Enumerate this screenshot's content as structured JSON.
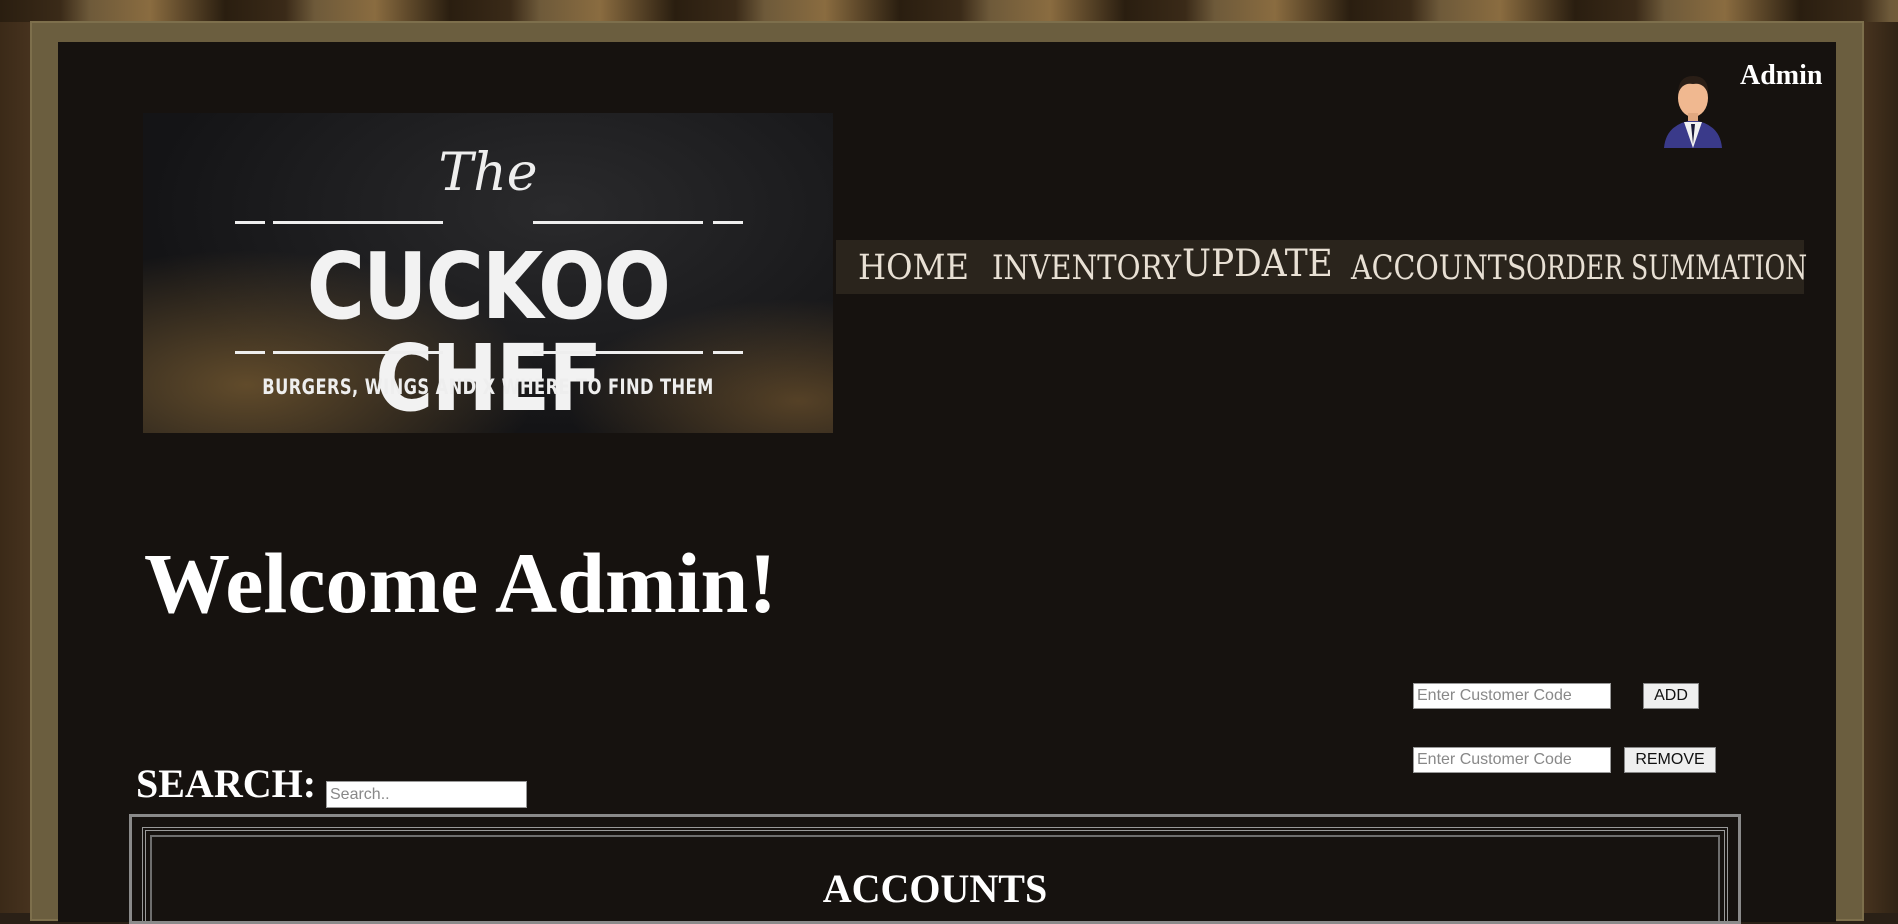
{
  "header": {
    "logo": {
      "the": "The",
      "name": "CUCKOO CHEF",
      "tagline": "BURGERS, WINGS AND X WHERE TO FIND THEM"
    },
    "user": {
      "name": "Admin"
    }
  },
  "nav": {
    "items": [
      {
        "label": "HOME"
      },
      {
        "label": "INVENTORY"
      },
      {
        "label": "UPDATE"
      },
      {
        "label": "ACCOUNTS"
      },
      {
        "label": "ORDER SUMMATION"
      }
    ]
  },
  "main": {
    "welcome": "Welcome Admin!",
    "add_form": {
      "placeholder": "Enter Customer Code",
      "button": "ADD"
    },
    "remove_form": {
      "placeholder": "Enter Customer Code",
      "button": "REMOVE"
    },
    "search": {
      "label": "SEARCH:",
      "placeholder": "Search.."
    },
    "accounts": {
      "title": "ACCOUNTS"
    }
  },
  "colors": {
    "panel": "#16120f",
    "frame": "#6b5e3f",
    "nav_bg": "#2a241c",
    "text": "#ffffff"
  }
}
